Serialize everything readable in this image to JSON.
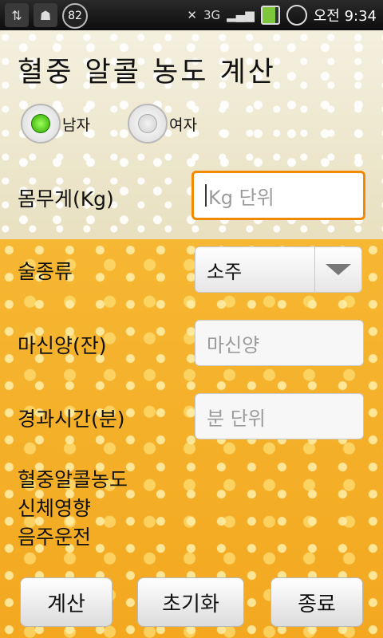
{
  "status_bar": {
    "icons": [
      "usb-icon",
      "android-debug-icon",
      "battery-level-badge"
    ],
    "battery_badge": "82",
    "network": "3G",
    "time": "오전 9:34"
  },
  "app": {
    "title": "혈중 알콜 농도 계산",
    "gender": {
      "options": [
        {
          "label": "남자",
          "selected": true
        },
        {
          "label": "여자",
          "selected": false
        }
      ]
    },
    "fields": {
      "weight": {
        "label": "몸무게(Kg)",
        "placeholder": "Kg 단위",
        "value": ""
      },
      "drink_type": {
        "label": "술종류",
        "selected": "소주"
      },
      "amount": {
        "label": "마신양(잔)",
        "placeholder": "마신양",
        "value": ""
      },
      "elapsed": {
        "label": "경과시간(분)",
        "placeholder": "분 단위",
        "value": ""
      }
    },
    "results": [
      "혈중알콜농도",
      "신체영향",
      "음주운전"
    ],
    "buttons": {
      "calculate": "계산",
      "reset": "초기화",
      "exit": "종료"
    }
  },
  "colors": {
    "focus_border": "#f28a00",
    "radio_selected": "#2da500",
    "beer": "#f3a820",
    "foam": "#efe8cf"
  }
}
